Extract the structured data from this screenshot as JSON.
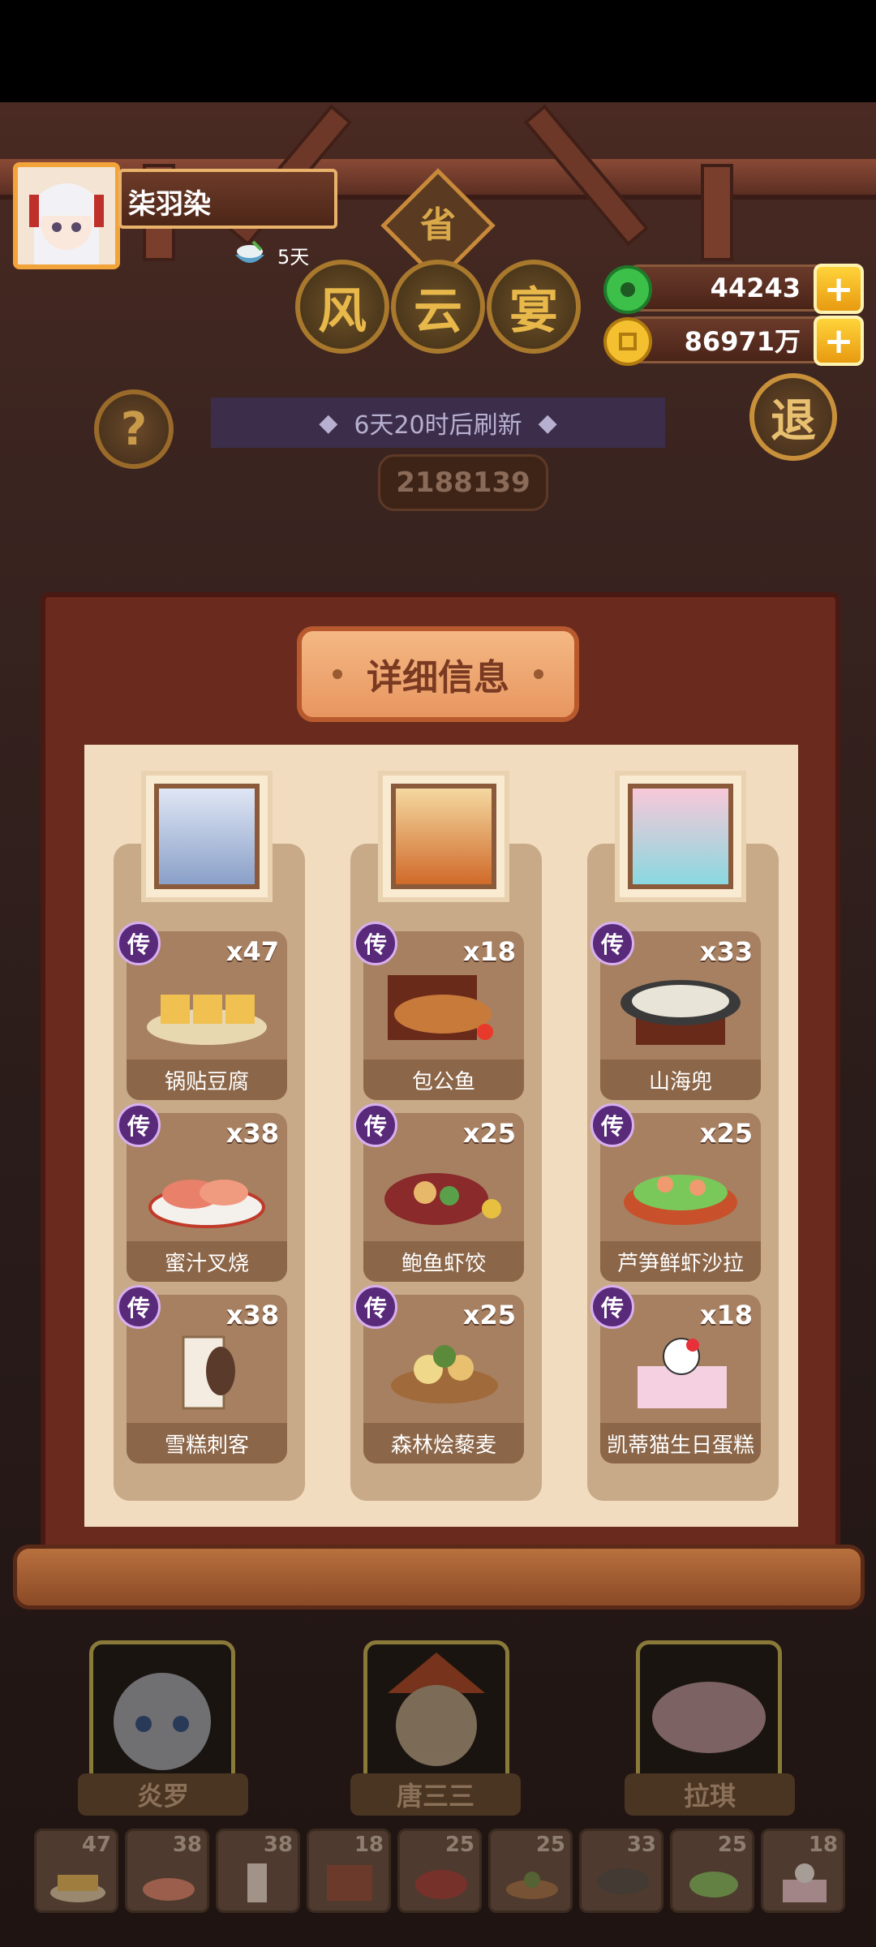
{
  "player": {
    "name": "柒羽染",
    "days": "5天"
  },
  "resources": {
    "jade": "44243",
    "coins": "86971万"
  },
  "buttons": {
    "help": "?",
    "exit": "退",
    "province": "省"
  },
  "event_title": [
    "风",
    "云",
    "宴"
  ],
  "refresh_text": "6天20时后刷新",
  "score": "2188139",
  "detail_title": "详细信息",
  "legend_tag": "传",
  "columns": [
    {
      "dishes": [
        {
          "name": "锅贴豆腐",
          "count": "x47"
        },
        {
          "name": "蜜汁叉烧",
          "count": "x38"
        },
        {
          "name": "雪糕刺客",
          "count": "x38"
        }
      ]
    },
    {
      "dishes": [
        {
          "name": "包公鱼",
          "count": "x18"
        },
        {
          "name": "鲍鱼虾饺",
          "count": "x25"
        },
        {
          "name": "森林烩藜麦",
          "count": "x25"
        }
      ]
    },
    {
      "dishes": [
        {
          "name": "山海兜",
          "count": "x33"
        },
        {
          "name": "芦笋鲜虾沙拉",
          "count": "x25"
        },
        {
          "name": "凯蒂猫生日蛋糕",
          "count": "x18"
        }
      ]
    }
  ],
  "characters": [
    {
      "name": "炎罗"
    },
    {
      "name": "唐三三"
    },
    {
      "name": "拉琪"
    }
  ],
  "thumbs": [
    "47",
    "38",
    "38",
    "18",
    "25",
    "25",
    "33",
    "25",
    "18"
  ],
  "colors": {
    "accent": "#e89a10",
    "legend": "#5a2a7a",
    "panel": "#f1dcc0"
  }
}
